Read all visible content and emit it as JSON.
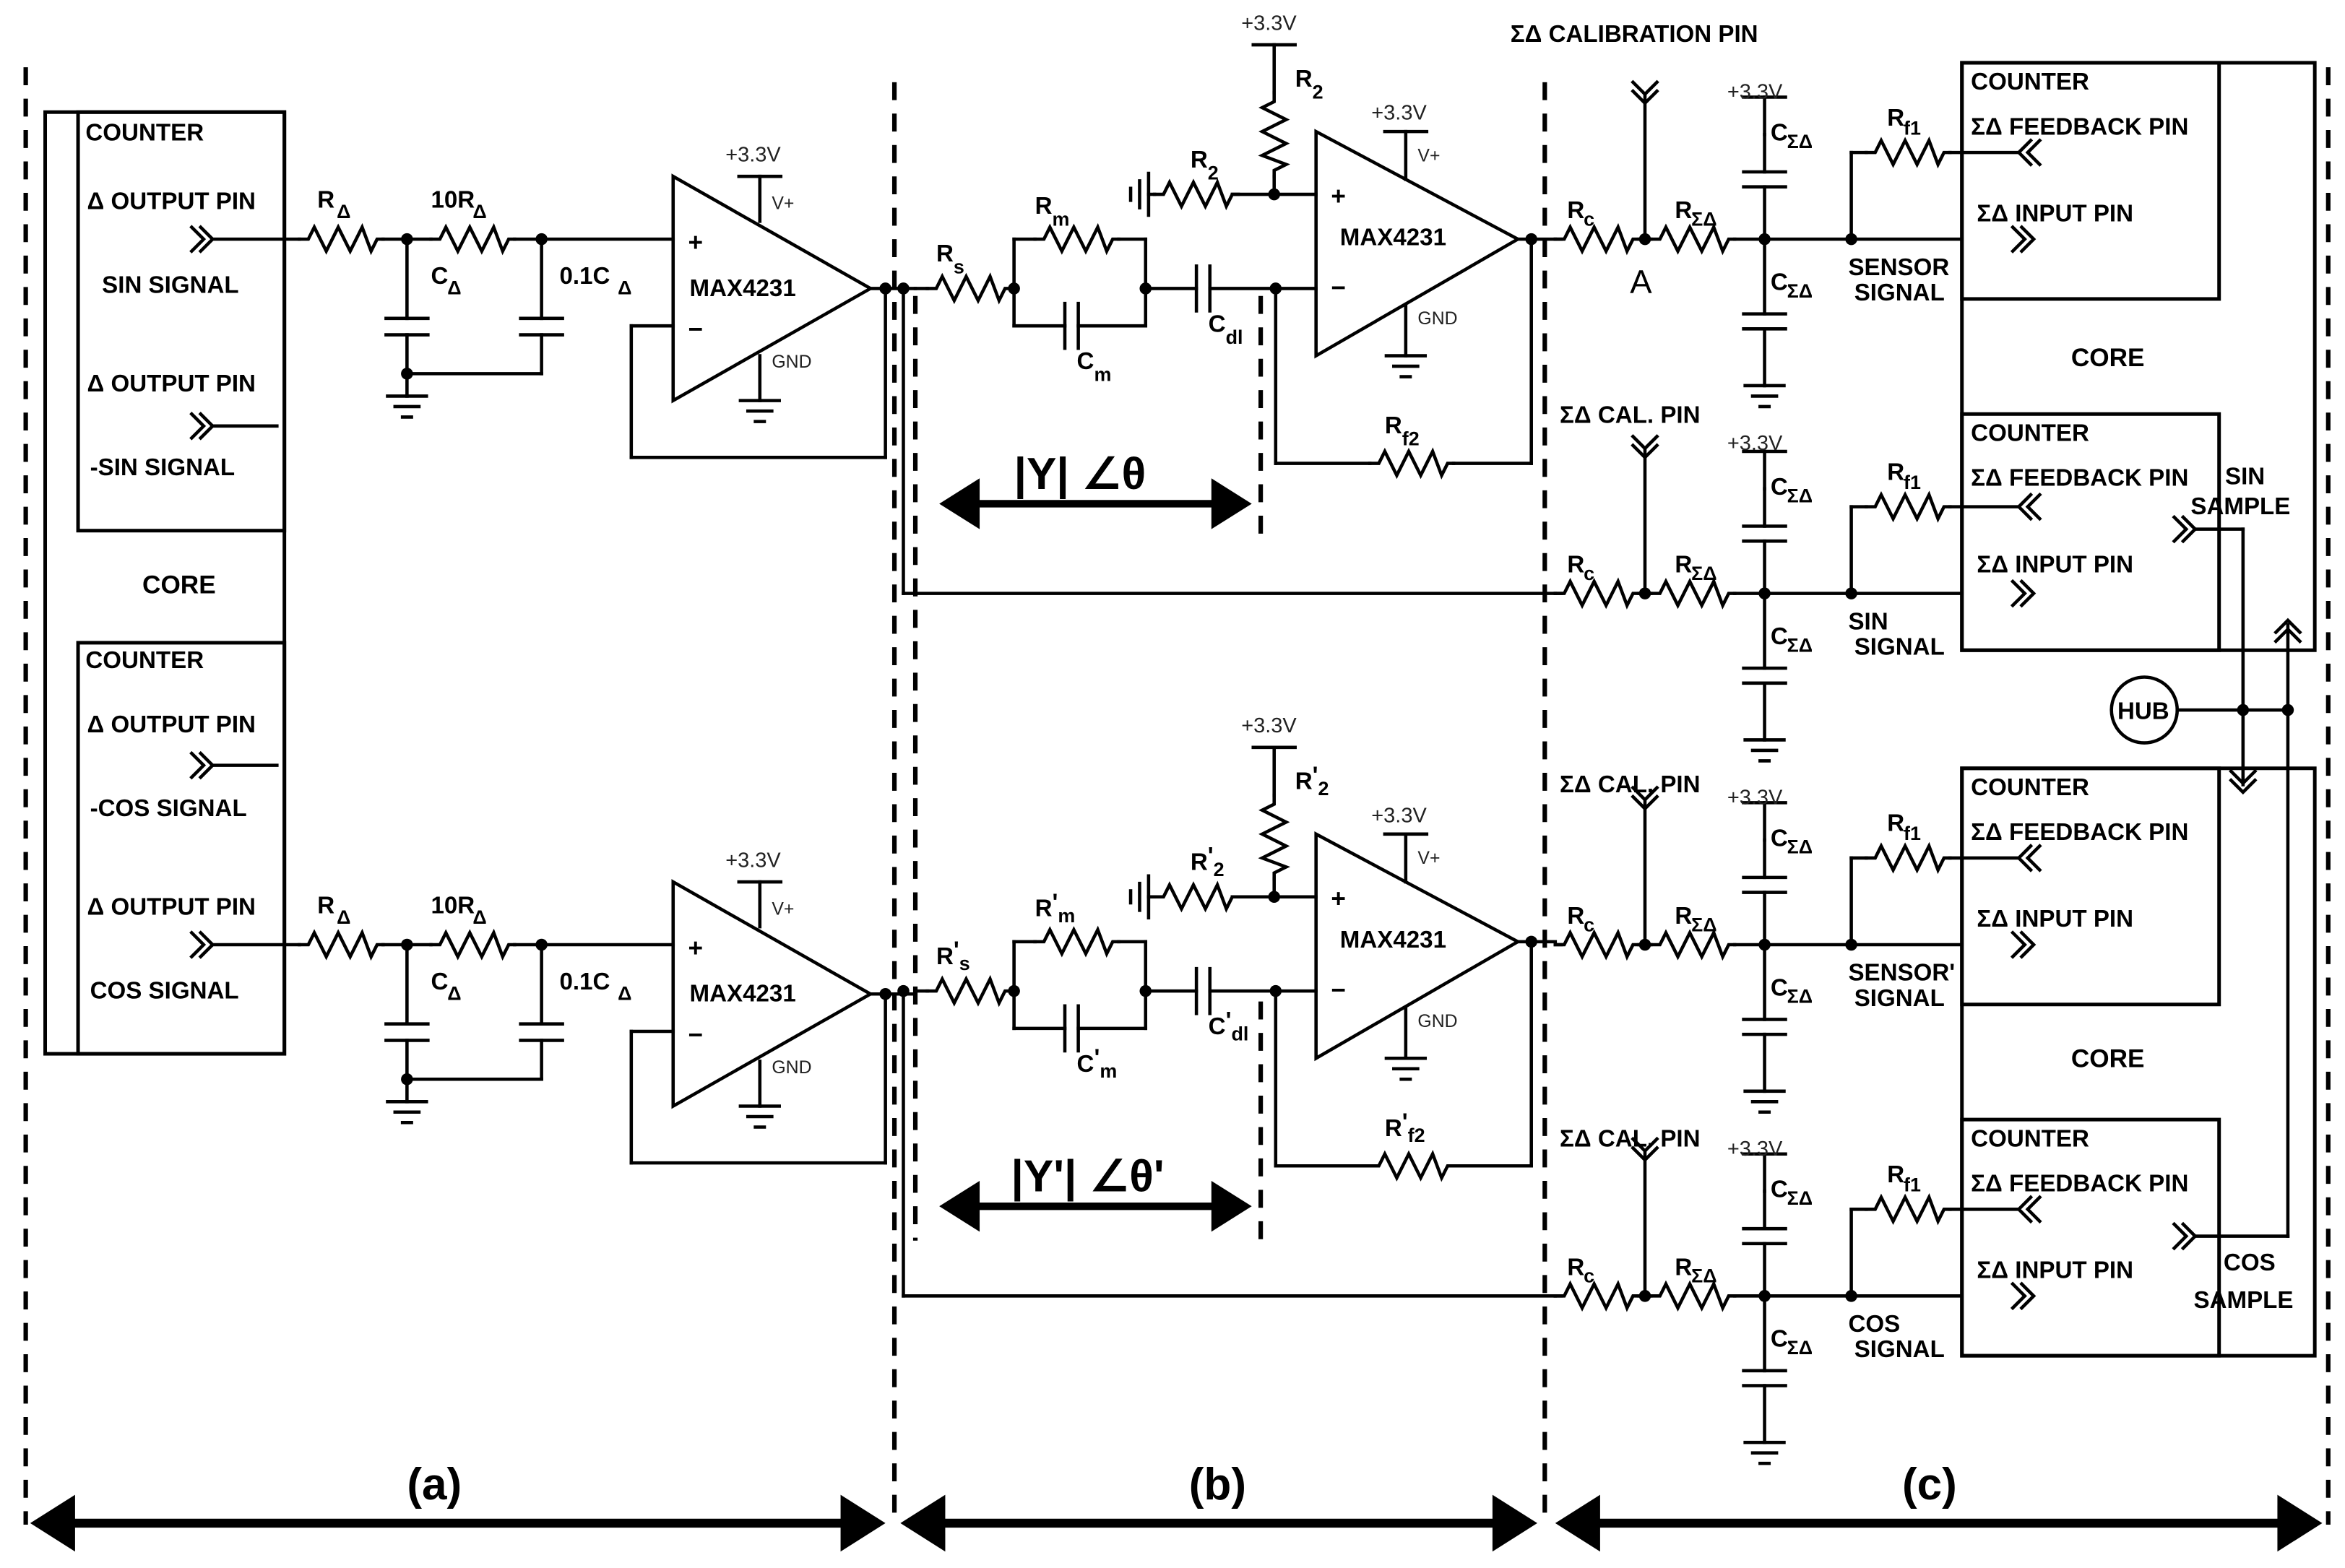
{
  "figure": {
    "sections": [
      {
        "id": "a",
        "label": "(a)"
      },
      {
        "id": "b",
        "label": "(b)"
      },
      {
        "id": "c",
        "label": "(c)"
      }
    ]
  },
  "section_a": {
    "mcu_left": {
      "core_label": "CORE",
      "counter_top": {
        "title": "COUNTER",
        "pin1_label": "Δ OUTPUT PIN",
        "pin1_signal": "SIN SIGNAL",
        "pin2_label": "Δ OUTPUT PIN",
        "pin2_signal": "-SIN SIGNAL"
      },
      "counter_bottom": {
        "title": "COUNTER",
        "pin1_label": "Δ OUTPUT PIN",
        "pin1_signal": "-COS SIGNAL",
        "pin2_label": "Δ OUTPUT PIN",
        "pin2_signal": "COS SIGNAL"
      }
    },
    "filter": {
      "r1": "R",
      "r1_sub": "Δ",
      "r2": "10R",
      "r2_sub": "Δ",
      "c1": "C",
      "c1_sub": "Δ",
      "c2": "0.1C",
      "c2_sub": "Δ"
    },
    "opamp": {
      "part": "MAX4231",
      "supply": "+3.3V",
      "vplus": "V+",
      "gnd": "GND",
      "plus": "+",
      "minus": "−"
    }
  },
  "section_b": {
    "top": {
      "rs": "R",
      "rs_sub": "s",
      "rs_prime": "",
      "rm": "R",
      "rm_sub": "m",
      "rm_prime": "",
      "cm": "C",
      "cm_sub": "m",
      "cm_prime": "",
      "cdl": "C",
      "cdl_sub": "dl",
      "cdl_prime": "",
      "r2a": "R",
      "r2a_sub": "2",
      "r2a_prime": "",
      "r2b": "R",
      "r2b_sub": "2",
      "r2b_prime": "",
      "rf2": "R",
      "rf2_sub": "f2",
      "rf2_prime": "",
      "supply_r2": "+3.3V",
      "impedance": "|Y|  ∠θ"
    },
    "bottom": {
      "rs": "R",
      "rs_sub": "s",
      "rs_prime": "'",
      "rm": "R",
      "rm_sub": "m",
      "rm_prime": "'",
      "cm": "C",
      "cm_sub": "m",
      "cm_prime": "'",
      "cdl": "C",
      "cdl_sub": "dl",
      "cdl_prime": "'",
      "r2a": "R",
      "r2a_sub": "2",
      "r2a_prime": "'",
      "r2b": "R",
      "r2b_sub": "2",
      "r2b_prime": "'",
      "rf2": "R",
      "rf2_sub": "f2",
      "rf2_prime": "'",
      "supply_r2": "+3.3V",
      "impedance": "|Y'| ∠θ'"
    },
    "opamp": {
      "part": "MAX4231",
      "supply": "+3.3V",
      "vplus": "V+",
      "gnd": "GND",
      "plus": "+",
      "minus": "−"
    }
  },
  "section_c": {
    "node_a_label": "A",
    "rows": [
      {
        "cal_pin": "ΣΔ CALIBRATION PIN",
        "signal_line1": "SENSOR",
        "signal_line2": "SIGNAL"
      },
      {
        "cal_pin": "ΣΔ CAL. PIN",
        "signal_line1": "SIN",
        "signal_line2": "SIGNAL"
      },
      {
        "cal_pin": "ΣΔ CAL. PIN",
        "signal_line1": "SENSOR'",
        "signal_line2": "SIGNAL"
      },
      {
        "cal_pin": "ΣΔ CAL. PIN",
        "signal_line1": "COS",
        "signal_line2": "SIGNAL"
      }
    ],
    "components": {
      "rc": "R",
      "rc_sub": "c",
      "rsd": "R",
      "rsd_sub": "ΣΔ",
      "csd": "C",
      "csd_sub": "ΣΔ",
      "rf1": "R",
      "rf1_sub": "f1",
      "supply": "+3.3V"
    },
    "counter": {
      "title": "COUNTER",
      "feedback_pin": "ΣΔ FEEDBACK PIN",
      "input_pin": "ΣΔ INPUT PIN"
    },
    "core_label": "CORE",
    "hub_label": "HUB",
    "sin_sample": [
      "SIN",
      "SAMPLE"
    ],
    "cos_sample": [
      "COS",
      "SAMPLE"
    ]
  }
}
